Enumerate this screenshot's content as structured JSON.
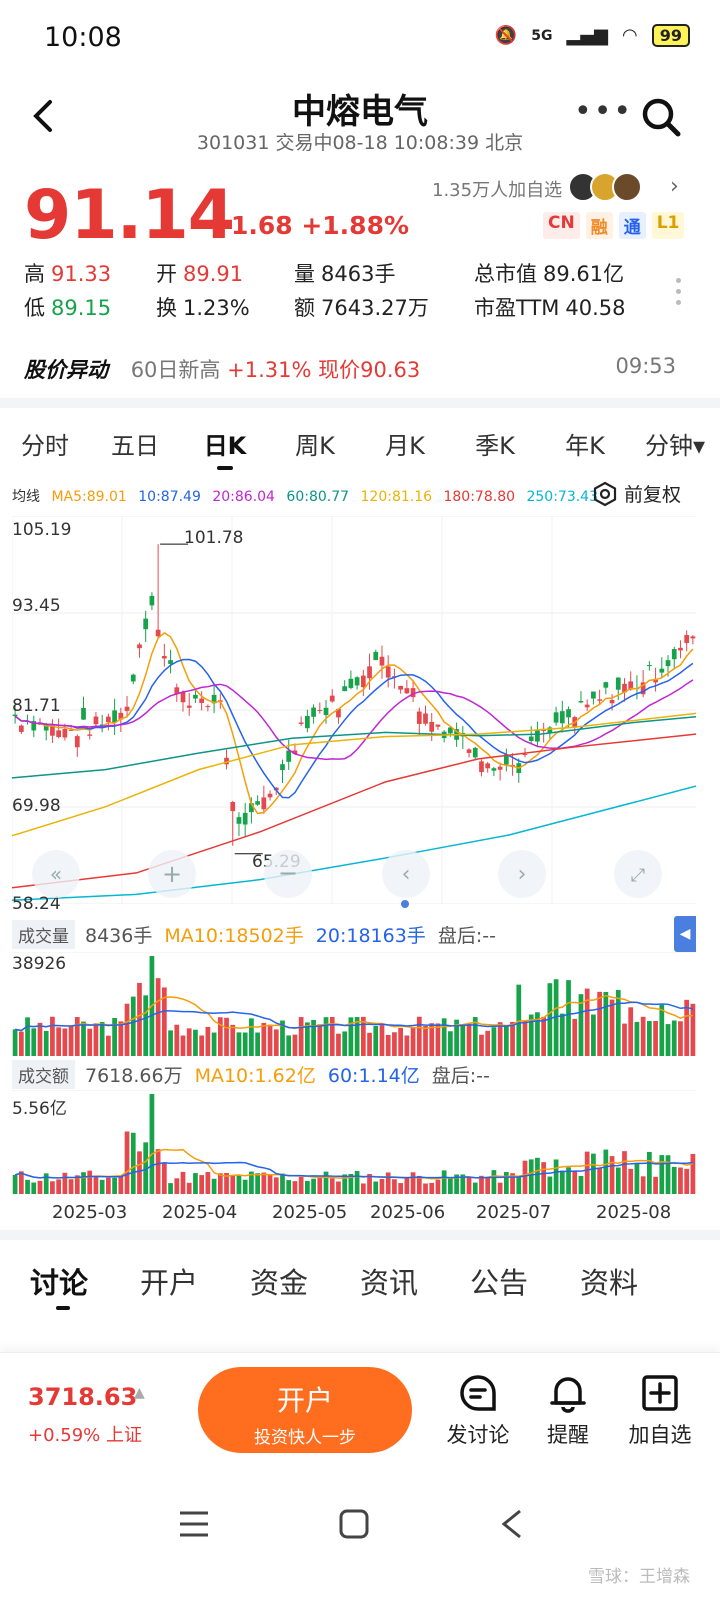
{
  "status": {
    "time": "10:08",
    "network": "5G",
    "battery": "99"
  },
  "header": {
    "title": "中熔电气",
    "subtitle": "301031 交易中08-18 10:08:39 北京"
  },
  "quote": {
    "price": "91.14",
    "change": "+1.68 +1.88%",
    "fans": "1.35万人加自选",
    "tags": [
      "CN",
      "融",
      "通",
      "L1"
    ],
    "stats": {
      "high_label": "高",
      "high": "91.33",
      "open_label": "开",
      "open": "89.91",
      "volume_label": "量",
      "volume": "8463手",
      "mktcap_label": "总市值",
      "mktcap": "89.61亿",
      "low_label": "低",
      "low": "89.15",
      "turnover_label": "换",
      "turnover": "1.23%",
      "amount_label": "额",
      "amount": "7643.27万",
      "pe_label": "市盈TTM",
      "pe": "40.58"
    }
  },
  "alert": {
    "title": "股价异动",
    "text_prefix": "60日新高",
    "text_value": "+1.31% 现价90.63",
    "time": "09:53"
  },
  "period_tabs": [
    "分时",
    "五日",
    "日K",
    "周K",
    "月K",
    "季K",
    "年K",
    "分钟▾"
  ],
  "active_period": 2,
  "ma_legend": {
    "label": "均线",
    "items": [
      {
        "text": "MA5:89.01",
        "color": "#f59e0b"
      },
      {
        "text": "10:87.49",
        "color": "#2563eb"
      },
      {
        "text": "20:86.04",
        "color": "#c026d3"
      },
      {
        "text": "60:80.77",
        "color": "#0d9488"
      },
      {
        "text": "120:81.16",
        "color": "#eab308"
      },
      {
        "text": "180:78.80",
        "color": "#e53935"
      },
      {
        "text": "250:73.43",
        "color": "#06b6d4"
      }
    ],
    "adjust": "前复权"
  },
  "chart_data": [
    {
      "type": "candlestick",
      "y_ticks": [
        "105.19",
        "93.45",
        "81.71",
        "69.98",
        "58.24"
      ],
      "ylim": [
        58.24,
        105.19
      ],
      "annotations": [
        {
          "text": "101.78",
          "value": 101.78
        },
        {
          "text": "65.29",
          "value": 65.29
        }
      ],
      "x_ticks": [
        "2025-03",
        "2025-04",
        "2025-05",
        "2025-06",
        "2025-07",
        "2025-08"
      ]
    },
    {
      "type": "bar",
      "label": "成交量",
      "legend": [
        {
          "text": "8436手",
          "color": "#555"
        },
        {
          "text": "MA10:18502手",
          "color": "#f59e0b"
        },
        {
          "text": "20:18163手",
          "color": "#2563eb"
        },
        {
          "text": "盘后:--",
          "color": "#555"
        }
      ],
      "y_max_label": "38926"
    },
    {
      "type": "bar",
      "label": "成交额",
      "legend": [
        {
          "text": "7618.66万",
          "color": "#555"
        },
        {
          "text": "MA10:1.62亿",
          "color": "#f59e0b"
        },
        {
          "text": "60:1.14亿",
          "color": "#2563eb"
        },
        {
          "text": "盘后:--",
          "color": "#555"
        }
      ],
      "y_max_label": "5.56亿"
    }
  ],
  "content_tabs": [
    "讨论",
    "开户",
    "资金",
    "资讯",
    "公告",
    "资料"
  ],
  "bottom": {
    "index_value": "3718.63",
    "index_change": "+0.59% 上证",
    "open_btn_title": "开户",
    "open_btn_sub": "投资快人一步",
    "actions": [
      "发讨论",
      "提醒",
      "加自选"
    ]
  },
  "watermark": "雪球：王增森"
}
